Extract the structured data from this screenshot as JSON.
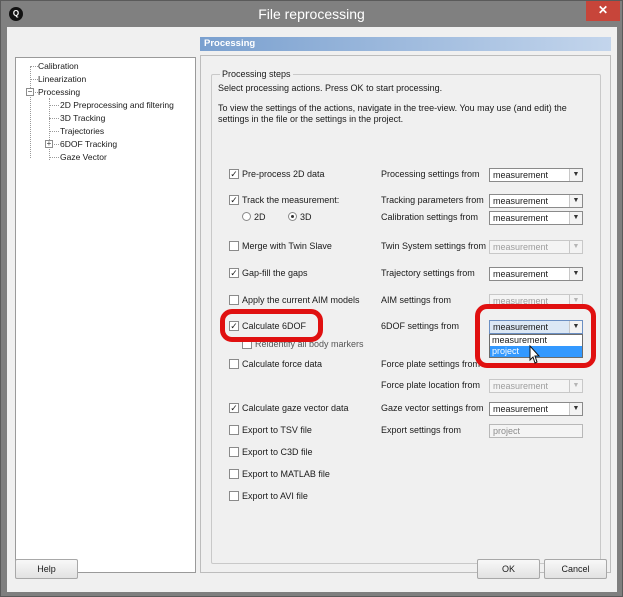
{
  "window": {
    "title": "File reprocessing",
    "close_label": "✕"
  },
  "tree": {
    "items": [
      {
        "label": "Calibration"
      },
      {
        "label": "Linearization"
      },
      {
        "label": "Processing"
      },
      {
        "label": "2D Preprocessing and filtering"
      },
      {
        "label": "3D Tracking"
      },
      {
        "label": "Trajectories"
      },
      {
        "label": "6DOF Tracking"
      },
      {
        "label": "Gaze Vector"
      }
    ]
  },
  "section_header": "Processing",
  "group": {
    "title": "Processing steps",
    "intro_line1": "Select processing actions. Press OK to start processing.",
    "intro_line2": "To view the settings of the actions, navigate in the tree-view. You may use (and edit) the",
    "intro_line3": "settings in the file or the settings in the project."
  },
  "steps": [
    {
      "label": "Pre-process 2D data",
      "checked": true
    },
    {
      "label": "Track the measurement:",
      "checked": true
    },
    {
      "label": "Merge with Twin Slave",
      "checked": false
    },
    {
      "label": "Gap-fill the gaps",
      "checked": true
    },
    {
      "label": "Apply the current AIM models",
      "checked": false
    },
    {
      "label": "Calculate 6DOF",
      "checked": true
    },
    {
      "label": "Calculate force data",
      "checked": false
    },
    {
      "label": "Calculate gaze vector data",
      "checked": true
    },
    {
      "label": "Export to TSV file",
      "checked": false
    },
    {
      "label": "Export to C3D file",
      "checked": false
    },
    {
      "label": "Export to MATLAB file",
      "checked": false
    },
    {
      "label": "Export to AVI file",
      "checked": false
    }
  ],
  "track_mode": {
    "option_2d": "2D",
    "option_3d": "3D",
    "selected": "3D"
  },
  "rigid_body_markers_label": "Reidentify all body markers",
  "settings": [
    {
      "label": "Processing settings from",
      "value": "measurement",
      "enabled": true
    },
    {
      "label": "Tracking parameters from",
      "value": "measurement",
      "enabled": true
    },
    {
      "label": "Calibration settings from",
      "value": "measurement",
      "enabled": true
    },
    {
      "label": "Twin System settings from",
      "value": "measurement",
      "enabled": false
    },
    {
      "label": "Trajectory settings from",
      "value": "measurement",
      "enabled": true
    },
    {
      "label": "AIM settings from",
      "value": "measurement",
      "enabled": false
    },
    {
      "label": "6DOF settings from",
      "value": "measurement",
      "enabled": true
    },
    {
      "label": "Force plate settings from",
      "value": "",
      "enabled": false
    },
    {
      "label": "Force plate location from",
      "value": "measurement",
      "enabled": false
    },
    {
      "label": "Gaze vector settings from",
      "value": "measurement",
      "enabled": true
    },
    {
      "label": "Export settings from",
      "value": "project",
      "enabled": false
    }
  ],
  "dropdown_6dof": {
    "options": [
      "measurement",
      "project"
    ],
    "highlighted": "project"
  },
  "buttons": {
    "help": "Help",
    "ok": "OK",
    "cancel": "Cancel"
  },
  "colors": {
    "highlight_ring": "#e01010",
    "header_bar": "#7aa0cf",
    "selection": "#3399ff"
  }
}
